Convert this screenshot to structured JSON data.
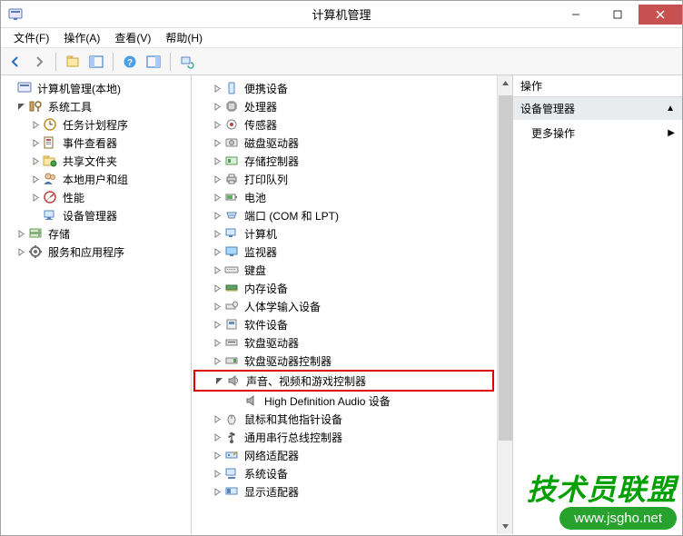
{
  "window": {
    "title": "计算机管理"
  },
  "menu": {
    "file": "文件(F)",
    "action": "操作(A)",
    "view": "查看(V)",
    "help": "帮助(H)"
  },
  "left_tree": {
    "root": "计算机管理(本地)",
    "system_tools": "系统工具",
    "system_children": {
      "scheduler": "任务计划程序",
      "eventviewer": "事件查看器",
      "shared": "共享文件夹",
      "users": "本地用户和组",
      "perf": "性能",
      "devmgr": "设备管理器"
    },
    "storage": "存储",
    "services": "服务和应用程序"
  },
  "center_tree": {
    "portable": "便携设备",
    "cpu": "处理器",
    "sensor": "传感器",
    "disk": "磁盘驱动器",
    "storagectrl": "存储控制器",
    "printq": "打印队列",
    "battery": "电池",
    "ports": "端口 (COM 和 LPT)",
    "computer": "计算机",
    "monitor": "监视器",
    "keyboard": "键盘",
    "memory": "内存设备",
    "hid": "人体学输入设备",
    "softdev": "软件设备",
    "floppy": "软盘驱动器",
    "floppyctrl": "软盘驱动器控制器",
    "sound": "声音、视频和游戏控制器",
    "sound_child": "High Definition Audio 设备",
    "mouse": "鼠标和其他指针设备",
    "usb": "通用串行总线控制器",
    "net": "网络适配器",
    "sysdev": "系统设备",
    "display": "显示适配器"
  },
  "actions": {
    "header": "操作",
    "section": "设备管理器",
    "more": "更多操作"
  },
  "watermark": {
    "big": "技术员联盟",
    "url": "www.jsgho.net"
  }
}
